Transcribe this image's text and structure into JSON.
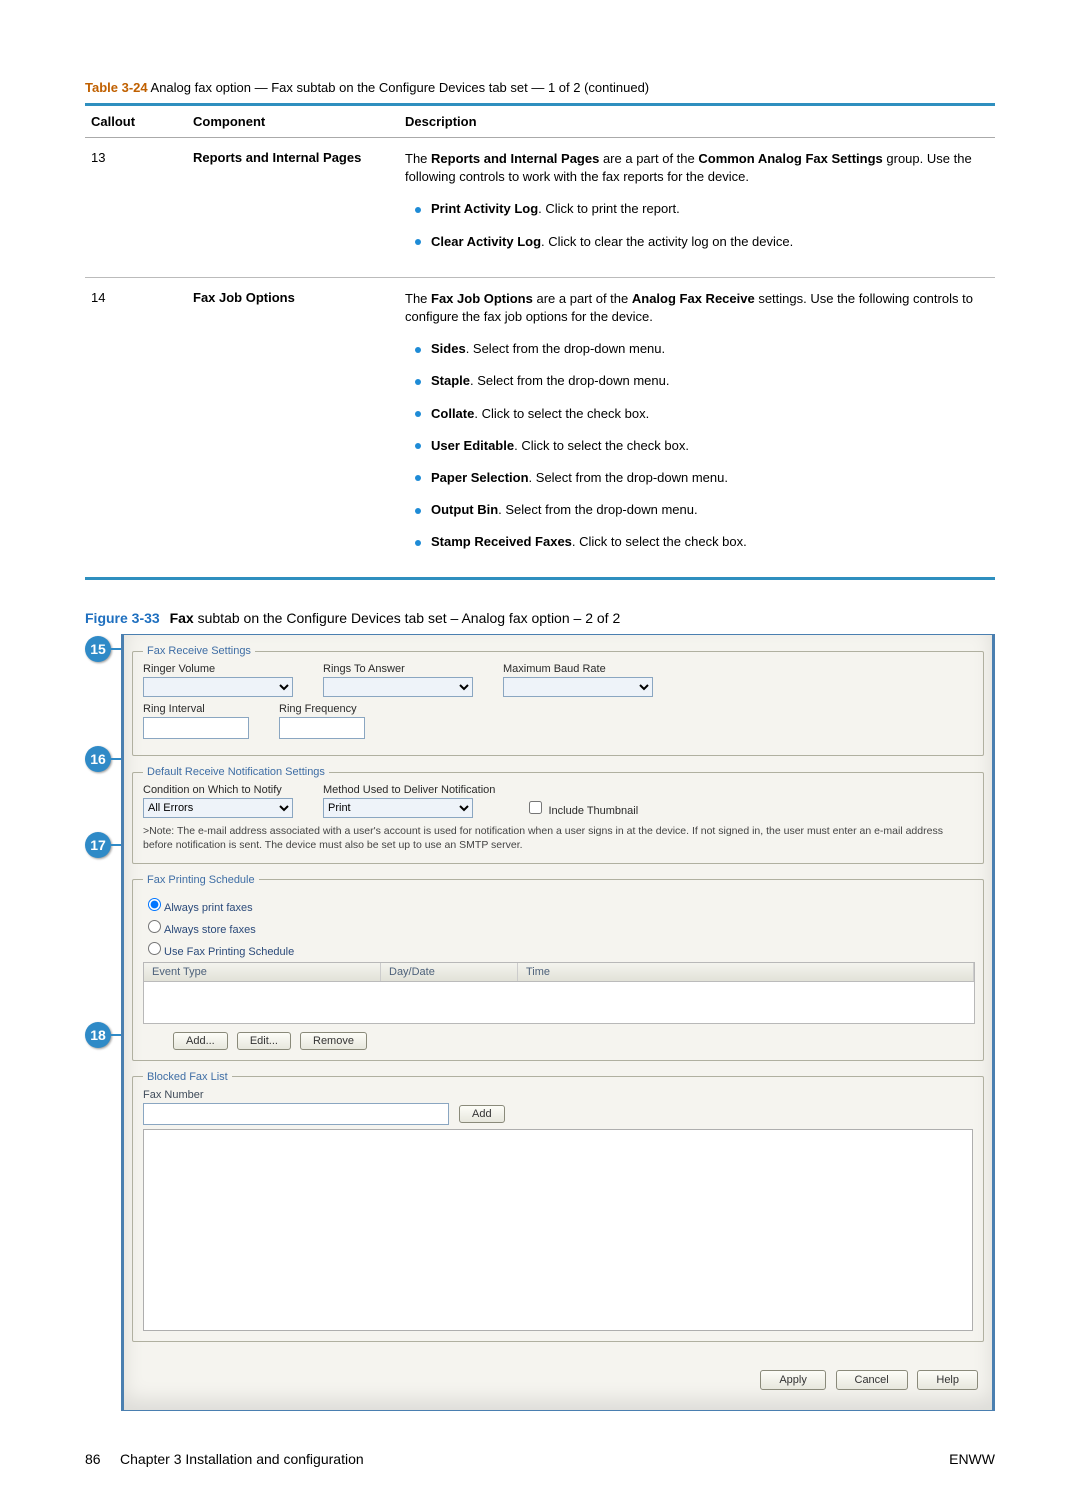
{
  "tableCaption": {
    "num": "Table 3-24",
    "text": "  Analog fax option — Fax subtab on the Configure Devices tab set — 1 of 2 (continued)"
  },
  "headers": {
    "c1": "Callout",
    "c2": "Component",
    "c3": "Description"
  },
  "row13": {
    "callout": "13",
    "component": "Reports and Internal Pages",
    "desc": {
      "para_prefix": "The ",
      "para_b1": "Reports and Internal Pages",
      "para_mid": " are a part of the ",
      "para_b2": "Common Analog Fax Settings",
      "para_suffix": " group. Use the following controls to work with the fax reports for the device.",
      "b1_b": "Print Activity Log",
      "b1_t": ". Click to print the report.",
      "b2_b": "Clear Activity Log",
      "b2_t": ". Click to clear the activity log on the device."
    }
  },
  "row14": {
    "callout": "14",
    "component": "Fax Job Options",
    "desc": {
      "para_prefix": "The ",
      "para_b1": "Fax Job Options",
      "para_mid": " are a part of the ",
      "para_b2": "Analog Fax Receive",
      "para_suffix": " settings. Use the following controls to configure the fax job options for the device.",
      "items": [
        {
          "b": "Sides",
          "t": ". Select from the drop-down menu."
        },
        {
          "b": "Staple",
          "t": ". Select from the drop-down menu."
        },
        {
          "b": "Collate",
          "t": ". Click to select the check box."
        },
        {
          "b": "User Editable",
          "t": ". Click to select the check box."
        },
        {
          "b": "Paper Selection",
          "t": ". Select from the drop-down menu."
        },
        {
          "b": "Output Bin",
          "t": ". Select from the drop-down menu."
        },
        {
          "b": "Stamp Received Faxes",
          "t": ". Click to select the check box."
        }
      ]
    }
  },
  "figCaption": {
    "num": "Figure 3-33",
    "bold": "Fax",
    "rest": " subtab on the Configure Devices tab set – Analog fax option – 2 of 2"
  },
  "callouts": {
    "c15": "15",
    "c16": "16",
    "c17": "17",
    "c18": "18"
  },
  "shot": {
    "grp15": {
      "legend": "Fax Receive Settings",
      "ringerVolume": "Ringer Volume",
      "ringsToAnswer": "Rings To Answer",
      "maxBaud": "Maximum Baud Rate",
      "ringInterval": "Ring Interval",
      "ringFrequency": "Ring Frequency"
    },
    "grp16": {
      "legend": "Default Receive Notification Settings",
      "condition": "Condition on Which to Notify",
      "conditionVal": "All Errors",
      "method": "Method Used to Deliver Notification",
      "methodVal": "Print",
      "include": "Include Thumbnail",
      "note": ">Note: The e-mail address associated with a user's account is used for notification when a user signs in at the device. If not signed in, the user must enter an e-mail address before notification is sent. The device must also be set up to use an SMTP server."
    },
    "grp17": {
      "legend": "Fax Printing Schedule",
      "r1": "Always print faxes",
      "r2": "Always store faxes",
      "r3": "Use Fax Printing Schedule",
      "colEvent": "Event Type",
      "colDay": "Day/Date",
      "colTime": "Time",
      "add": "Add...",
      "edit": "Edit...",
      "remove": "Remove"
    },
    "grp18": {
      "legend": "Blocked Fax List",
      "faxNumber": "Fax Number",
      "add": "Add"
    },
    "buttons": {
      "apply": "Apply",
      "cancel": "Cancel",
      "help": "Help"
    }
  },
  "footer": {
    "pageNum": "86",
    "chapter": "Chapter 3   Installation and configuration",
    "enww": "ENWW"
  }
}
